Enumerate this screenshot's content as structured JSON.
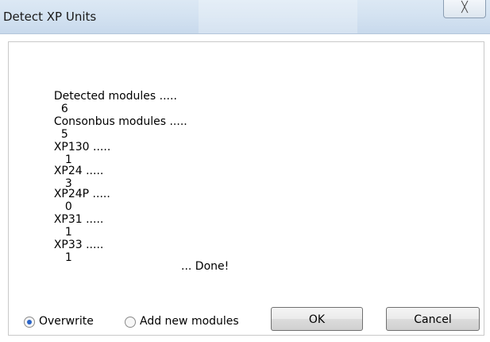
{
  "window": {
    "title": "Detect XP Units",
    "close_glyph": "╳"
  },
  "results": [
    {
      "label": "Detected modules .....",
      "value": "6"
    },
    {
      "label": "Consonbus modules .....",
      "value": "5"
    },
    {
      "label": "XP130 .....",
      "value": "1"
    },
    {
      "label": "XP24 .....",
      "value": "3"
    },
    {
      "label": "XP24P .....",
      "value": "0"
    },
    {
      "label": "XP31 .....",
      "value": "1"
    },
    {
      "label": "XP33 .....",
      "value": "1"
    }
  ],
  "status": "... Done!",
  "options": {
    "overwrite_label": "Overwrite",
    "add_new_label": "Add new modules",
    "selected": "overwrite"
  },
  "buttons": {
    "ok_label": "OK",
    "cancel_label": "Cancel"
  },
  "colors": {
    "titlebar": "#d3e2f1",
    "radio_selected": "#2a64c8"
  }
}
